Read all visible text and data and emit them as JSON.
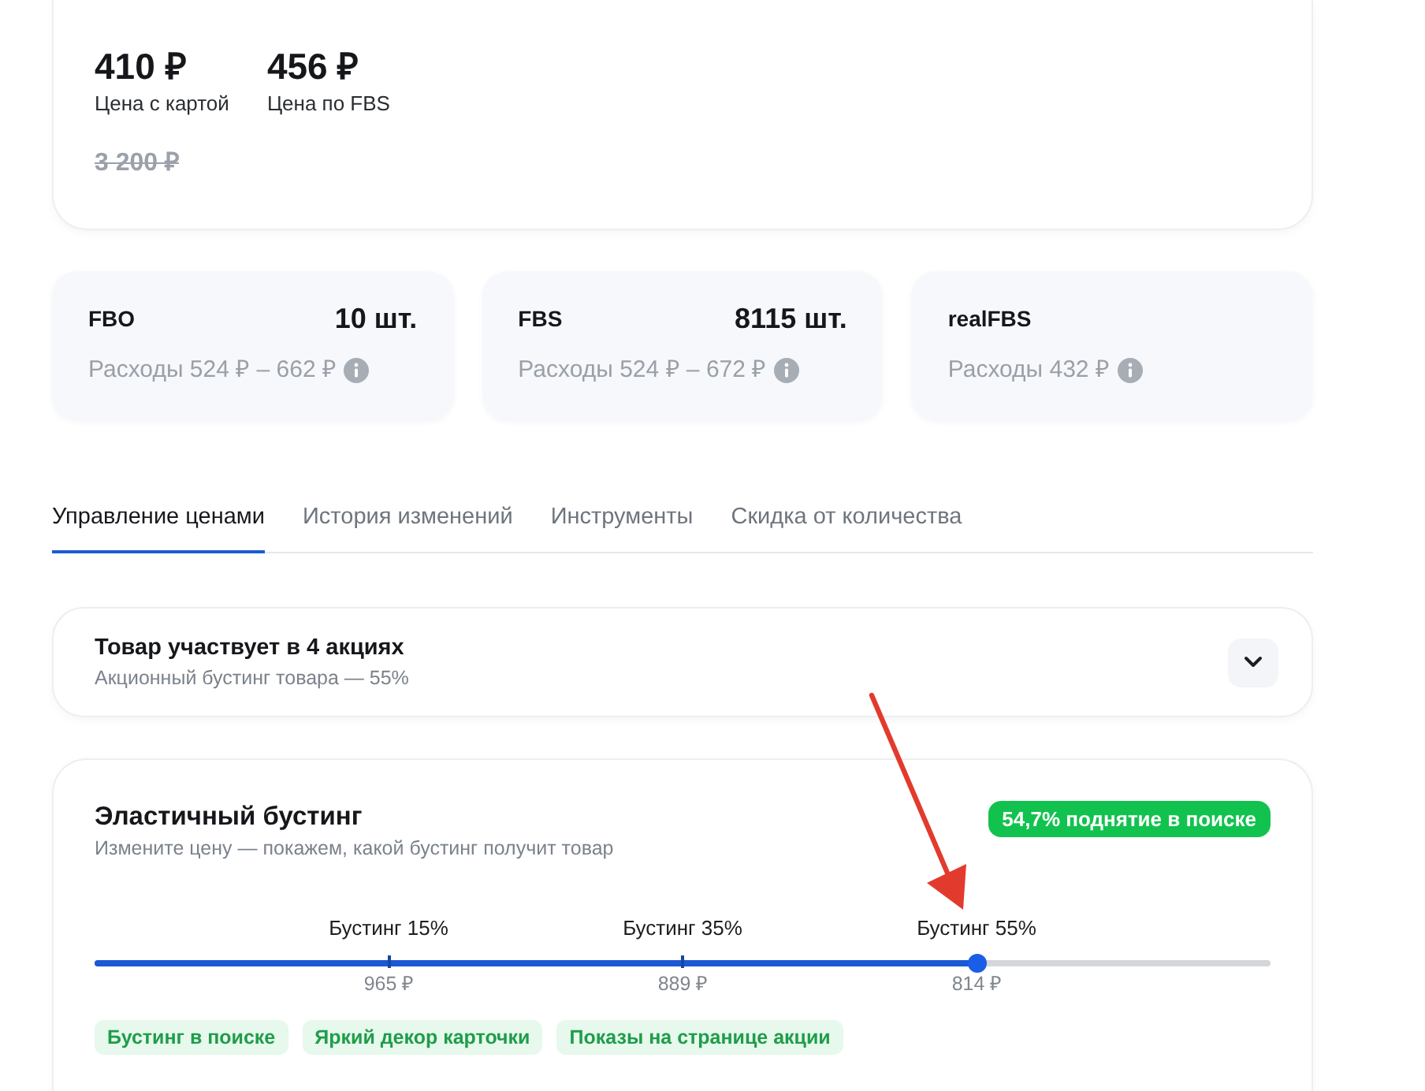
{
  "prices": {
    "items": [
      {
        "value": "410 ₽",
        "label": "Цена с картой"
      },
      {
        "value": "456 ₽",
        "label": "Цена по FBS"
      }
    ],
    "old_price": "3 200 ₽"
  },
  "stock": [
    {
      "scheme": "FBO",
      "count": "10 шт.",
      "expenses": "Расходы 524 ₽ – 662 ₽"
    },
    {
      "scheme": "FBS",
      "count": "8115 шт.",
      "expenses": "Расходы 524 ₽ – 672 ₽"
    },
    {
      "scheme": "realFBS",
      "expenses": "Расходы 432 ₽"
    }
  ],
  "tabs": [
    {
      "label": "Управление ценами",
      "selected": true
    },
    {
      "label": "История изменений",
      "selected": false
    },
    {
      "label": "Инструменты",
      "selected": false
    },
    {
      "label": "Скидка от количества",
      "selected": false
    }
  ],
  "promotions": {
    "title": "Товар участвует в 4 акциях",
    "subtitle": "Акционный бустинг товара — 55%",
    "expanded": false
  },
  "boosting": {
    "title": "Эластичный бустинг",
    "subtitle": "Измените цену — покажем, какой бустинг получит товар",
    "badge": "54,7% поднятие в поиске",
    "slider": {
      "level": 0.75,
      "stops": [
        {
          "label": "Бустинг 15%",
          "price": "965 ₽"
        },
        {
          "label": "Бустинг 35%",
          "price": "889 ₽"
        },
        {
          "label": "Бустинг 55%",
          "price": "814 ₽"
        }
      ]
    },
    "features": [
      "Бустинг в поиске",
      "Яркий декор карточки",
      "Показы на странице акции"
    ]
  }
}
